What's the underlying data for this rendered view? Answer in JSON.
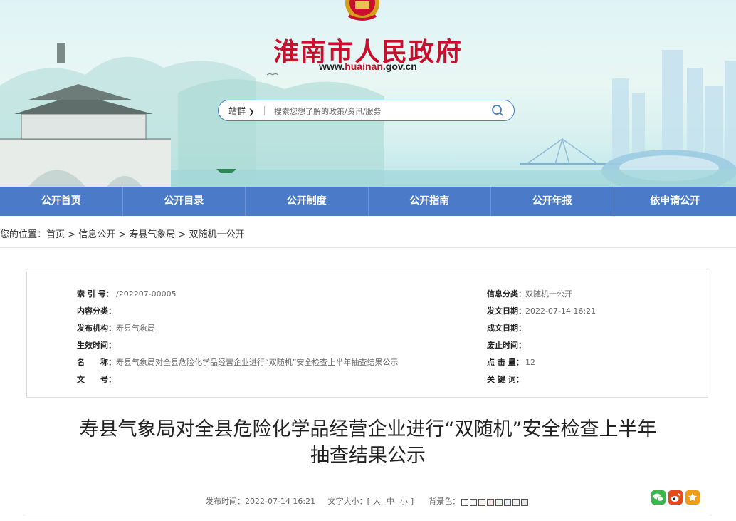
{
  "header": {
    "site_title": "淮南市人民政府",
    "url_prefix": "www.",
    "url_brand": "huainan",
    "url_suffix": ".gov.cn",
    "search": {
      "scope": "站群",
      "placeholder": "搜索您想了解的政策/资讯/服务"
    }
  },
  "nav": {
    "items": [
      {
        "label": "公开首页"
      },
      {
        "label": "公开目录"
      },
      {
        "label": "公开制度"
      },
      {
        "label": "公开指南"
      },
      {
        "label": "公开年报"
      },
      {
        "label": "依申请公开"
      }
    ]
  },
  "breadcrumb": {
    "prefix": "您的位置：",
    "items": [
      "首页",
      "信息公开",
      "寿县气象局",
      "双随机一公开"
    ],
    "sep": " > "
  },
  "meta": {
    "left": [
      {
        "key": "索 引 号：",
        "value": "/202207-00005"
      },
      {
        "key": "内容分类：",
        "value": ""
      },
      {
        "key": "发布机构：",
        "value": "寿县气象局"
      },
      {
        "key": "生效时间：",
        "value": ""
      },
      {
        "key": "名　　称：",
        "value": "寿县气象局对全县危险化学品经营企业进行“双随机”安全检查上半年抽查结果公示"
      },
      {
        "key": "文　　号：",
        "value": ""
      }
    ],
    "right": [
      {
        "key": "信息分类：",
        "value": "双随机一公开"
      },
      {
        "key": "发文日期：",
        "value": "2022-07-14 16:21"
      },
      {
        "key": "成文日期：",
        "value": ""
      },
      {
        "key": "废止时间：",
        "value": ""
      },
      {
        "key": "点 击 量：",
        "value": "12"
      },
      {
        "key": "关 键 词：",
        "value": ""
      }
    ]
  },
  "article": {
    "title_line1": "寿县气象局对全县危险化学品经营企业进行“双随机”安全检查上半年",
    "title_line2": "抽查结果公示",
    "publish_label": "发布时间：",
    "publish_time": "2022-07-14 16:21",
    "font_label": "文字大小：[",
    "font_large": "大",
    "font_medium": "中",
    "font_small": "小",
    "font_close": "]",
    "bg_label": "背景色：",
    "bg_colors": [
      "#ffffff",
      "#f9f9f9",
      "#f5f1e8",
      "#fbe9ea",
      "#eaf5ea",
      "#e8f1f8",
      "#f0f0f0",
      "#e6e6e6"
    ]
  },
  "share": {
    "icons": [
      {
        "name": "wechat-icon",
        "color": "#3db64b"
      },
      {
        "name": "weibo-icon",
        "color": "#e64a19"
      },
      {
        "name": "favorite-star-icon",
        "color": "#f39c12"
      }
    ]
  }
}
